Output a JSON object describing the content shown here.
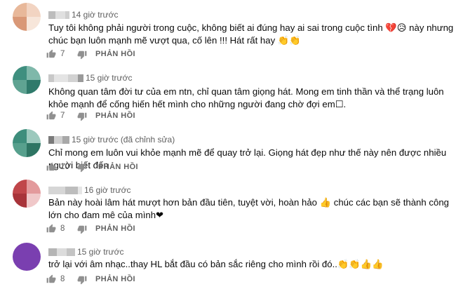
{
  "comments": [
    {
      "time": "14 giờ trước",
      "edited": "",
      "text": "Tuy tôi không phải người trong cuộc, không biết ai đúng hay ai sai trong cuộc tình 💔😥 này nhưng chúc bạn luôn mạnh mẽ vượt qua, cố lên !!! Hát rất hay 👏👏",
      "likes": "7",
      "reply_label": "PHẢN HỒI",
      "avatar_colors": [
        "#e8b89a",
        "#f2d4c2",
        "#d99877",
        "#f7e6da"
      ]
    },
    {
      "time": "15 giờ trước",
      "edited": "",
      "text": "Không quan tâm đời tư của em ntn, chỉ quan tâm giọng hát. Mong em tinh thần và thể trạng luôn khỏe mạnh để cống hiến hết mình cho những người đang chờ đợi em☐.",
      "likes": "7",
      "reply_label": "PHẢN HỒI",
      "avatar_colors": [
        "#3f8f7f",
        "#7fb8aa",
        "#5fa392",
        "#2f7a6b"
      ]
    },
    {
      "time": "15 giờ trước",
      "edited": "(đã chỉnh sửa)",
      "text": "Chỉ mong em luôn vui khỏe mạnh mẽ để quay trở lại. Giọng hát đẹp như thế này nên được nhiều người biết đến",
      "likes": "10",
      "reply_label": "PHẢN HỒI",
      "avatar_colors": [
        "#3e8e7c",
        "#9cc9bd",
        "#57a08d",
        "#2e7563"
      ]
    },
    {
      "time": "16 giờ trước",
      "edited": "",
      "text": "Bản này hoài lâm hát mượt hơn bản đầu tiên, tuyệt vời, hoàn hảo 👍 chúc các bạn sẽ thành công lớn cho đam mê của mình❤",
      "likes": "8",
      "reply_label": "PHẢN HỒI",
      "avatar_colors": [
        "#c0464a",
        "#e39a9c",
        "#a8343a",
        "#f0c8c9"
      ]
    },
    {
      "time": "15 giờ trước",
      "edited": "",
      "text": "trở lại với âm nhạc..thay HL bắt đầu có bản sắc riêng cho mình rồi đó..👏👏👍👍",
      "likes": "8",
      "reply_label": "PHẢN HỒI",
      "avatar_colors": [
        "#7a3fb0",
        "#7a3fb0",
        "#7a3fb0",
        "#7a3fb0"
      ]
    }
  ],
  "icons": {
    "like": "thumbs-up-icon",
    "dislike": "thumbs-down-icon"
  }
}
